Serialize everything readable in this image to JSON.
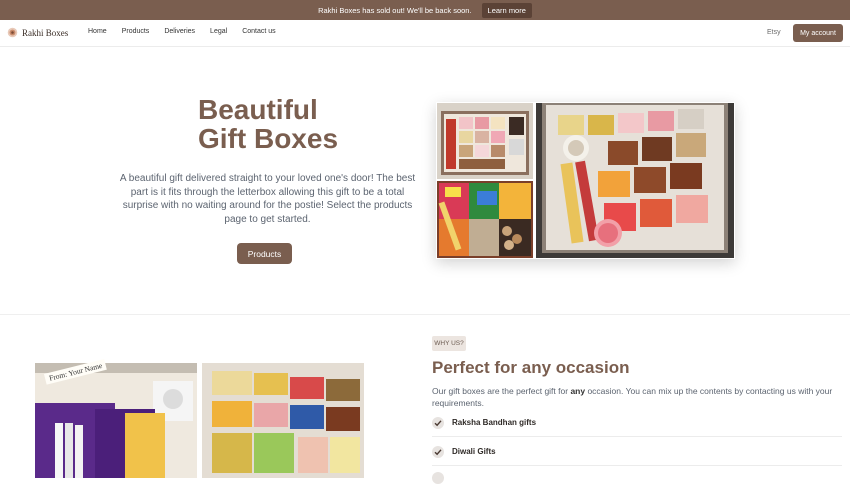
{
  "banner": {
    "text": "Rakhi Boxes has sold out! We'll be back soon.",
    "button": "Learn more"
  },
  "nav": {
    "brand": "Rakhi Boxes",
    "links": [
      "Home",
      "Products",
      "Deliveries",
      "Legal",
      "Contact us"
    ],
    "etsy": "Etsy",
    "account": "My account"
  },
  "hero": {
    "title_line1": "Beautiful",
    "title_line2": "Gift Boxes",
    "description": "A beautiful gift delivered straight to your loved one's door! The best part is it fits through the letterbox allowing this gift to be a total surprise with no waiting around for the postie! Select the products page to get started.",
    "button": "Products"
  },
  "why": {
    "badge": "WHY US?",
    "title": "Perfect for any occasion",
    "desc_pre": "Our gift boxes are the perfect gift for ",
    "desc_bold": "any",
    "desc_post": " occasion. You can mix up the contents by contacting us with your requirements.",
    "features": [
      "Raksha Bandhan gifts",
      "Diwali Gifts"
    ]
  },
  "photos": {
    "note_label": "From: Your Name"
  },
  "colors": {
    "brand": "#7a5e4f",
    "banner": "#7a5e4f"
  }
}
